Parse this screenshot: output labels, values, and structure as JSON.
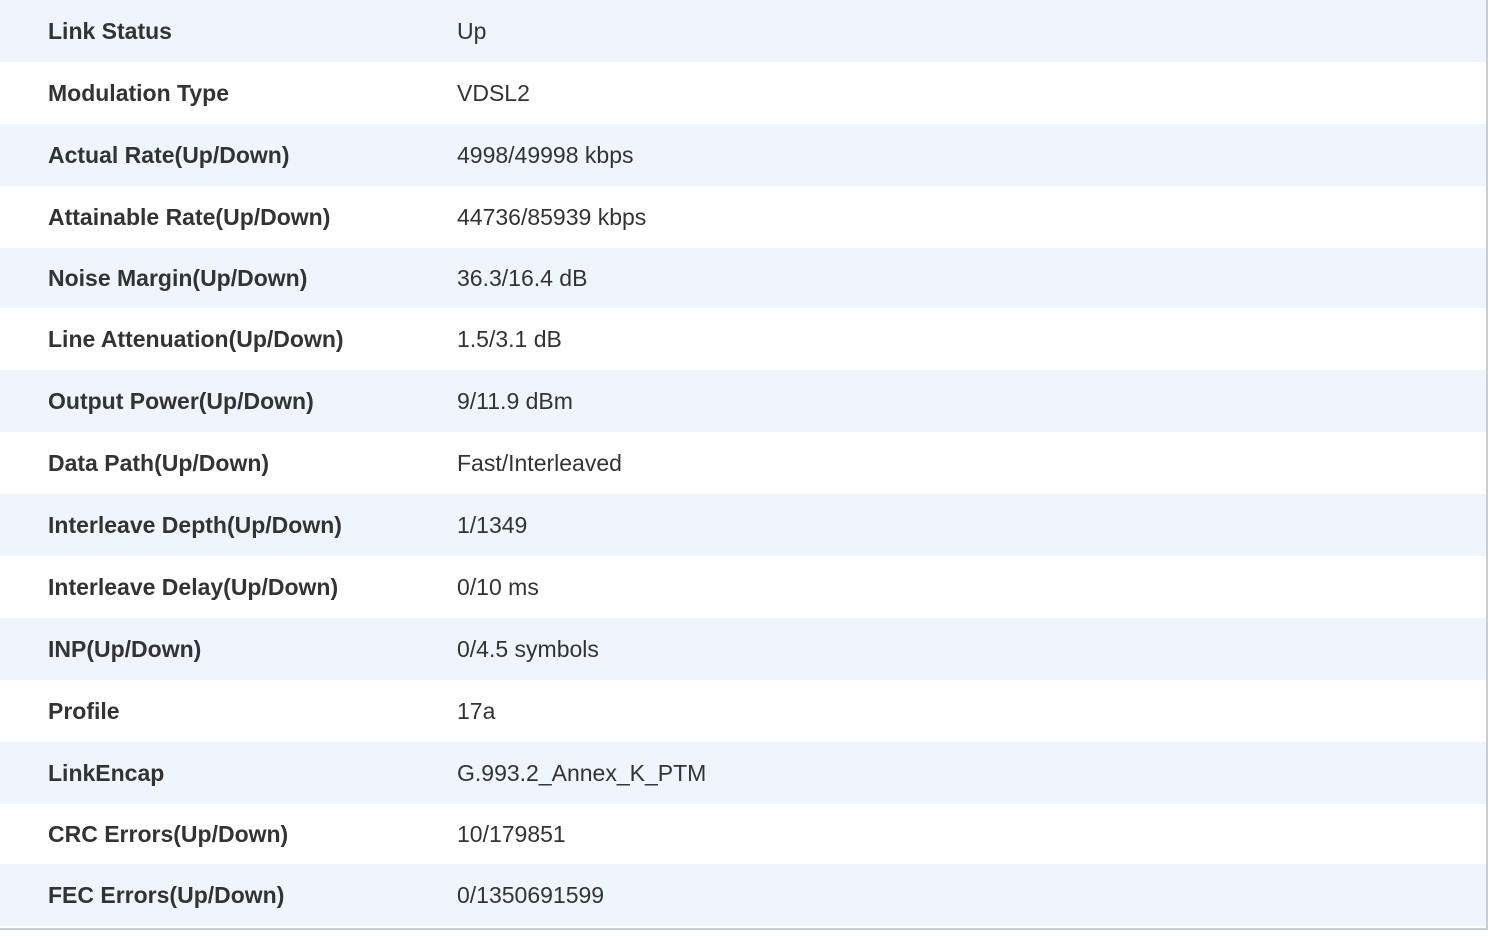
{
  "dsl_status": {
    "rows": [
      {
        "label": "Link Status",
        "value": "Up"
      },
      {
        "label": "Modulation Type",
        "value": "VDSL2"
      },
      {
        "label": "Actual Rate(Up/Down)",
        "value": "4998/49998 kbps"
      },
      {
        "label": "Attainable Rate(Up/Down)",
        "value": "44736/85939 kbps"
      },
      {
        "label": "Noise Margin(Up/Down)",
        "value": "36.3/16.4 dB"
      },
      {
        "label": "Line Attenuation(Up/Down)",
        "value": "1.5/3.1 dB"
      },
      {
        "label": "Output Power(Up/Down)",
        "value": "9/11.9 dBm"
      },
      {
        "label": "Data Path(Up/Down)",
        "value": "Fast/Interleaved"
      },
      {
        "label": "Interleave Depth(Up/Down)",
        "value": "1/1349"
      },
      {
        "label": "Interleave Delay(Up/Down)",
        "value": "0/10 ms"
      },
      {
        "label": "INP(Up/Down)",
        "value": "0/4.5 symbols"
      },
      {
        "label": "Profile",
        "value": "17a"
      },
      {
        "label": "LinkEncap",
        "value": "G.993.2_Annex_K_PTM"
      },
      {
        "label": "CRC Errors(Up/Down)",
        "value": "10/179851"
      },
      {
        "label": "FEC Errors(Up/Down)",
        "value": "0/1350691599"
      }
    ]
  }
}
